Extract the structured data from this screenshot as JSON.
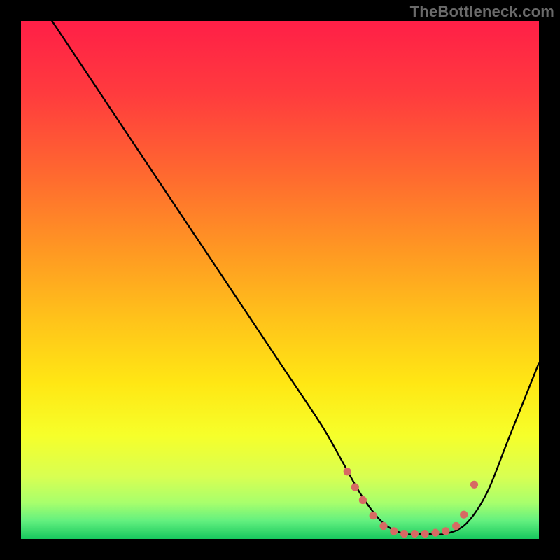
{
  "watermark": "TheBottleneck.com",
  "gradient": {
    "stops": [
      {
        "offset": 0.0,
        "color": "#ff1f47"
      },
      {
        "offset": 0.14,
        "color": "#ff3b3e"
      },
      {
        "offset": 0.3,
        "color": "#ff6a2f"
      },
      {
        "offset": 0.45,
        "color": "#ff9a22"
      },
      {
        "offset": 0.58,
        "color": "#ffc41a"
      },
      {
        "offset": 0.7,
        "color": "#ffe714"
      },
      {
        "offset": 0.8,
        "color": "#f6ff2a"
      },
      {
        "offset": 0.88,
        "color": "#d8ff52"
      },
      {
        "offset": 0.93,
        "color": "#a8ff6c"
      },
      {
        "offset": 0.965,
        "color": "#63f07f"
      },
      {
        "offset": 1.0,
        "color": "#17c85e"
      }
    ]
  },
  "chart_data": {
    "type": "line",
    "title": "",
    "xlabel": "",
    "ylabel": "",
    "xlim": [
      0,
      100
    ],
    "ylim": [
      0,
      100
    ],
    "series": [
      {
        "name": "curve",
        "x": [
          6,
          10,
          20,
          30,
          40,
          50,
          58,
          62,
          66,
          70,
          74,
          78,
          82,
          86,
          90,
          94,
          100
        ],
        "y": [
          100,
          94,
          79,
          64,
          49,
          34,
          22,
          15,
          8,
          3,
          1,
          1,
          1,
          3,
          9,
          19,
          34
        ]
      }
    ],
    "markers": {
      "name": "dotted-segment",
      "color": "#d76a63",
      "radius": 5.6,
      "points": [
        {
          "x": 63.0,
          "y": 13.0
        },
        {
          "x": 64.5,
          "y": 10.0
        },
        {
          "x": 66.0,
          "y": 7.5
        },
        {
          "x": 68.0,
          "y": 4.5
        },
        {
          "x": 70.0,
          "y": 2.5
        },
        {
          "x": 72.0,
          "y": 1.5
        },
        {
          "x": 74.0,
          "y": 1.0
        },
        {
          "x": 76.0,
          "y": 1.0
        },
        {
          "x": 78.0,
          "y": 1.0
        },
        {
          "x": 80.0,
          "y": 1.2
        },
        {
          "x": 82.0,
          "y": 1.5
        },
        {
          "x": 84.0,
          "y": 2.5
        },
        {
          "x": 85.5,
          "y": 4.7
        },
        {
          "x": 87.5,
          "y": 10.5
        }
      ]
    }
  }
}
